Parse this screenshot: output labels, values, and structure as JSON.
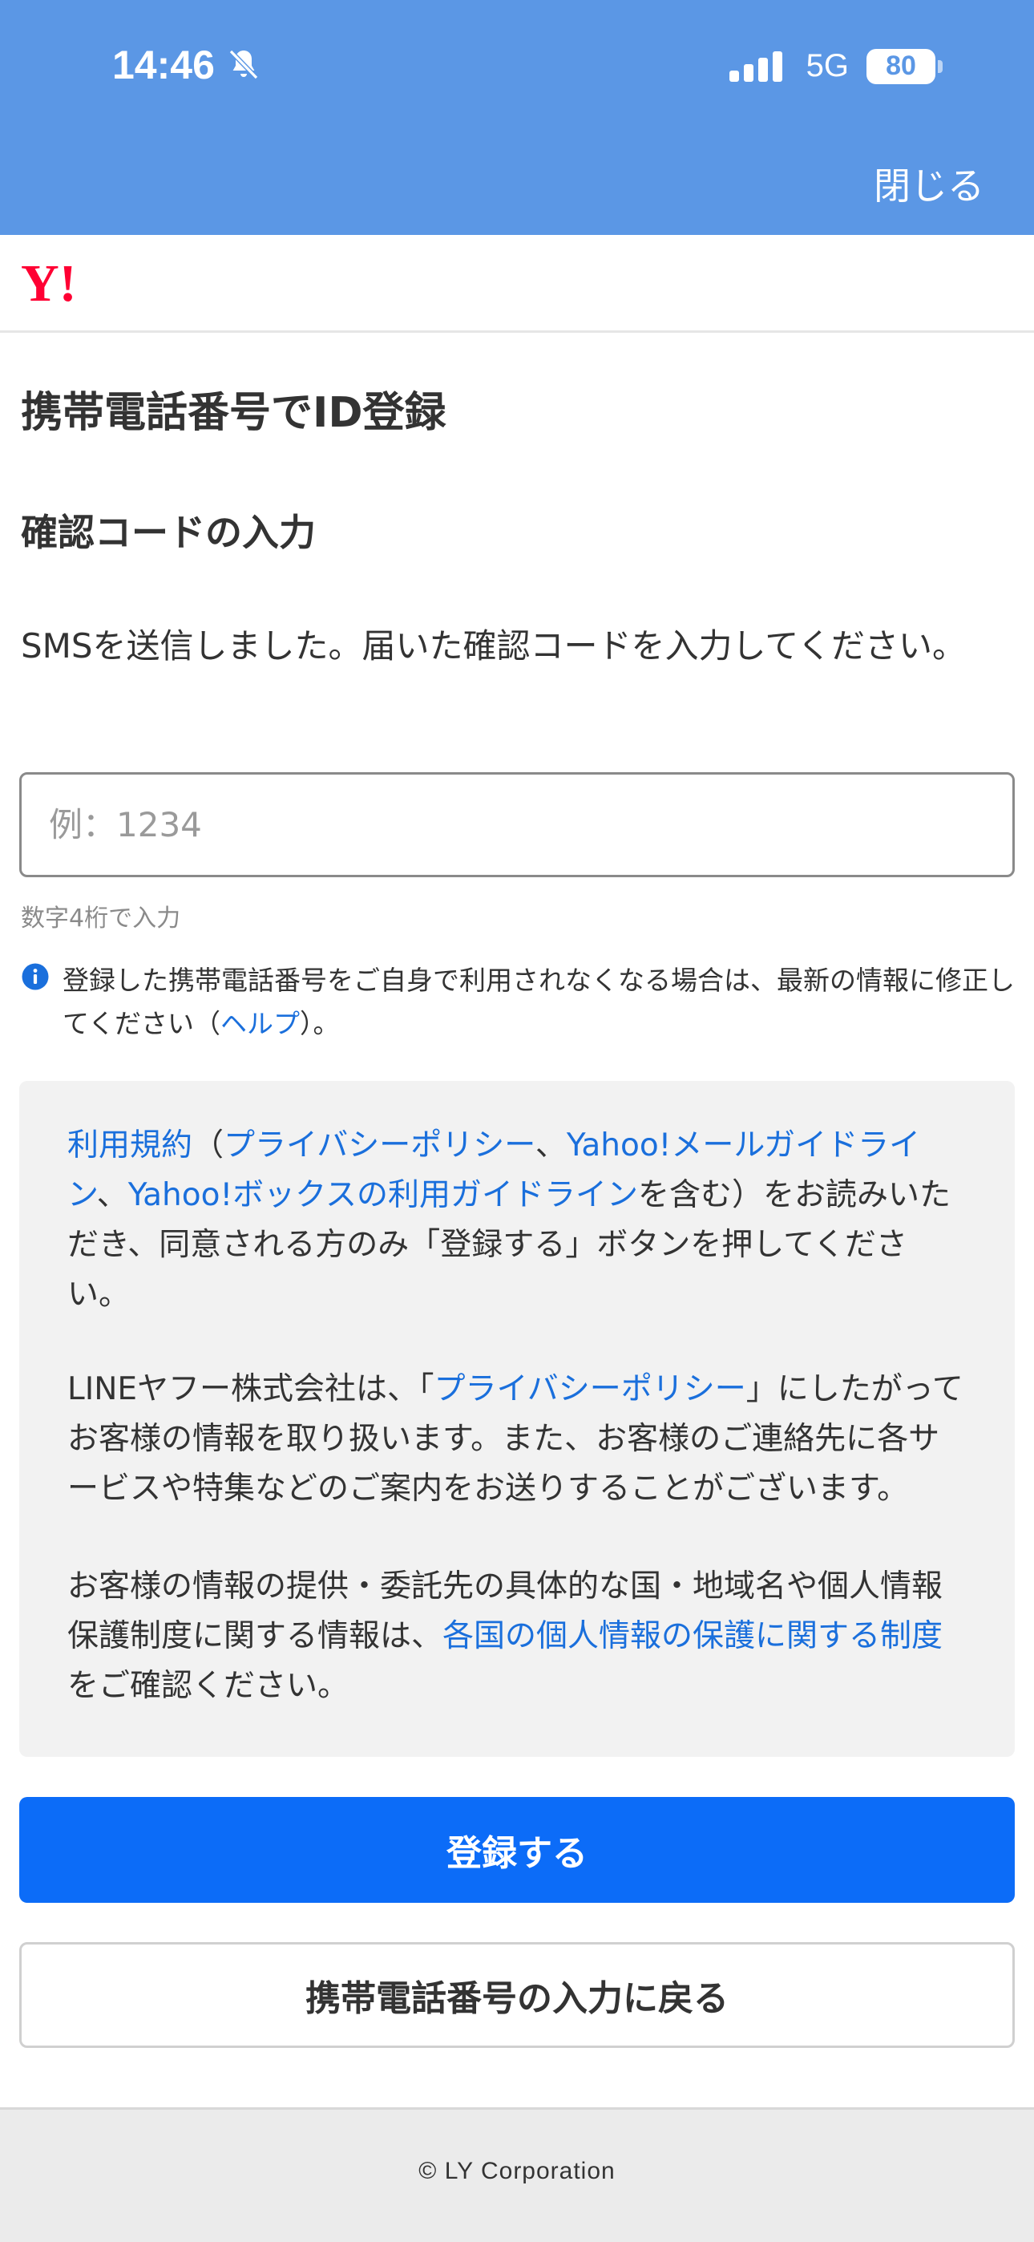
{
  "status_bar": {
    "time": "14:46",
    "network": "5G",
    "battery": "80"
  },
  "header": {
    "close_label": "閉じる"
  },
  "logo": {
    "text": "Y!",
    "color": "#ff0033"
  },
  "page": {
    "title": "携帯電話番号でID登録",
    "section_heading": "確認コードの入力",
    "instruction": "SMSを送信しました。届いた確認コードを入力してください。"
  },
  "code_input": {
    "placeholder": "例：1234",
    "value": "",
    "hint": "数字4桁で入力"
  },
  "notice": {
    "text_before": "登録した携帯電話番号をご自身で利用されなくなる場合は、最新の情報に修正してください（",
    "help_link": "ヘルプ",
    "text_after": "）。"
  },
  "terms": {
    "p1": {
      "link_terms": "利用規約",
      "t1": "（",
      "link_privacy": "プライバシーポリシー",
      "t2": "、",
      "link_mail": "Yahoo!メールガイドライン",
      "t3": "、",
      "link_box": "Yahoo!ボックスの利用ガイドライン",
      "t4": "を含む）をお読みいただき、同意される方のみ「登録する」ボタンを押してください。"
    },
    "p2": {
      "t1": "LINEヤフー株式会社は、「",
      "link_privacy": "プライバシーポリシー",
      "t2": "」にしたがってお客様の情報を取り扱います。また、お客様のご連絡先に各サービスや特集などのご案内をお送りすることがございます。"
    },
    "p3": {
      "t1": "お客様の情報の提供・委託先の具体的な国・地域名や個人情報保護制度に関する情報は、",
      "link_systems": "各国の個人情報の保護に関する制度",
      "t2": "をご確認ください。"
    }
  },
  "buttons": {
    "register": "登録する",
    "back": "携帯電話番号の入力に戻る"
  },
  "footer": {
    "copyright": "© LY Corporation"
  },
  "colors": {
    "header_bg": "#5b97e5",
    "primary_button": "#0c6cf8",
    "link": "#1a6fdc",
    "terms_bg": "#f2f2f2"
  }
}
